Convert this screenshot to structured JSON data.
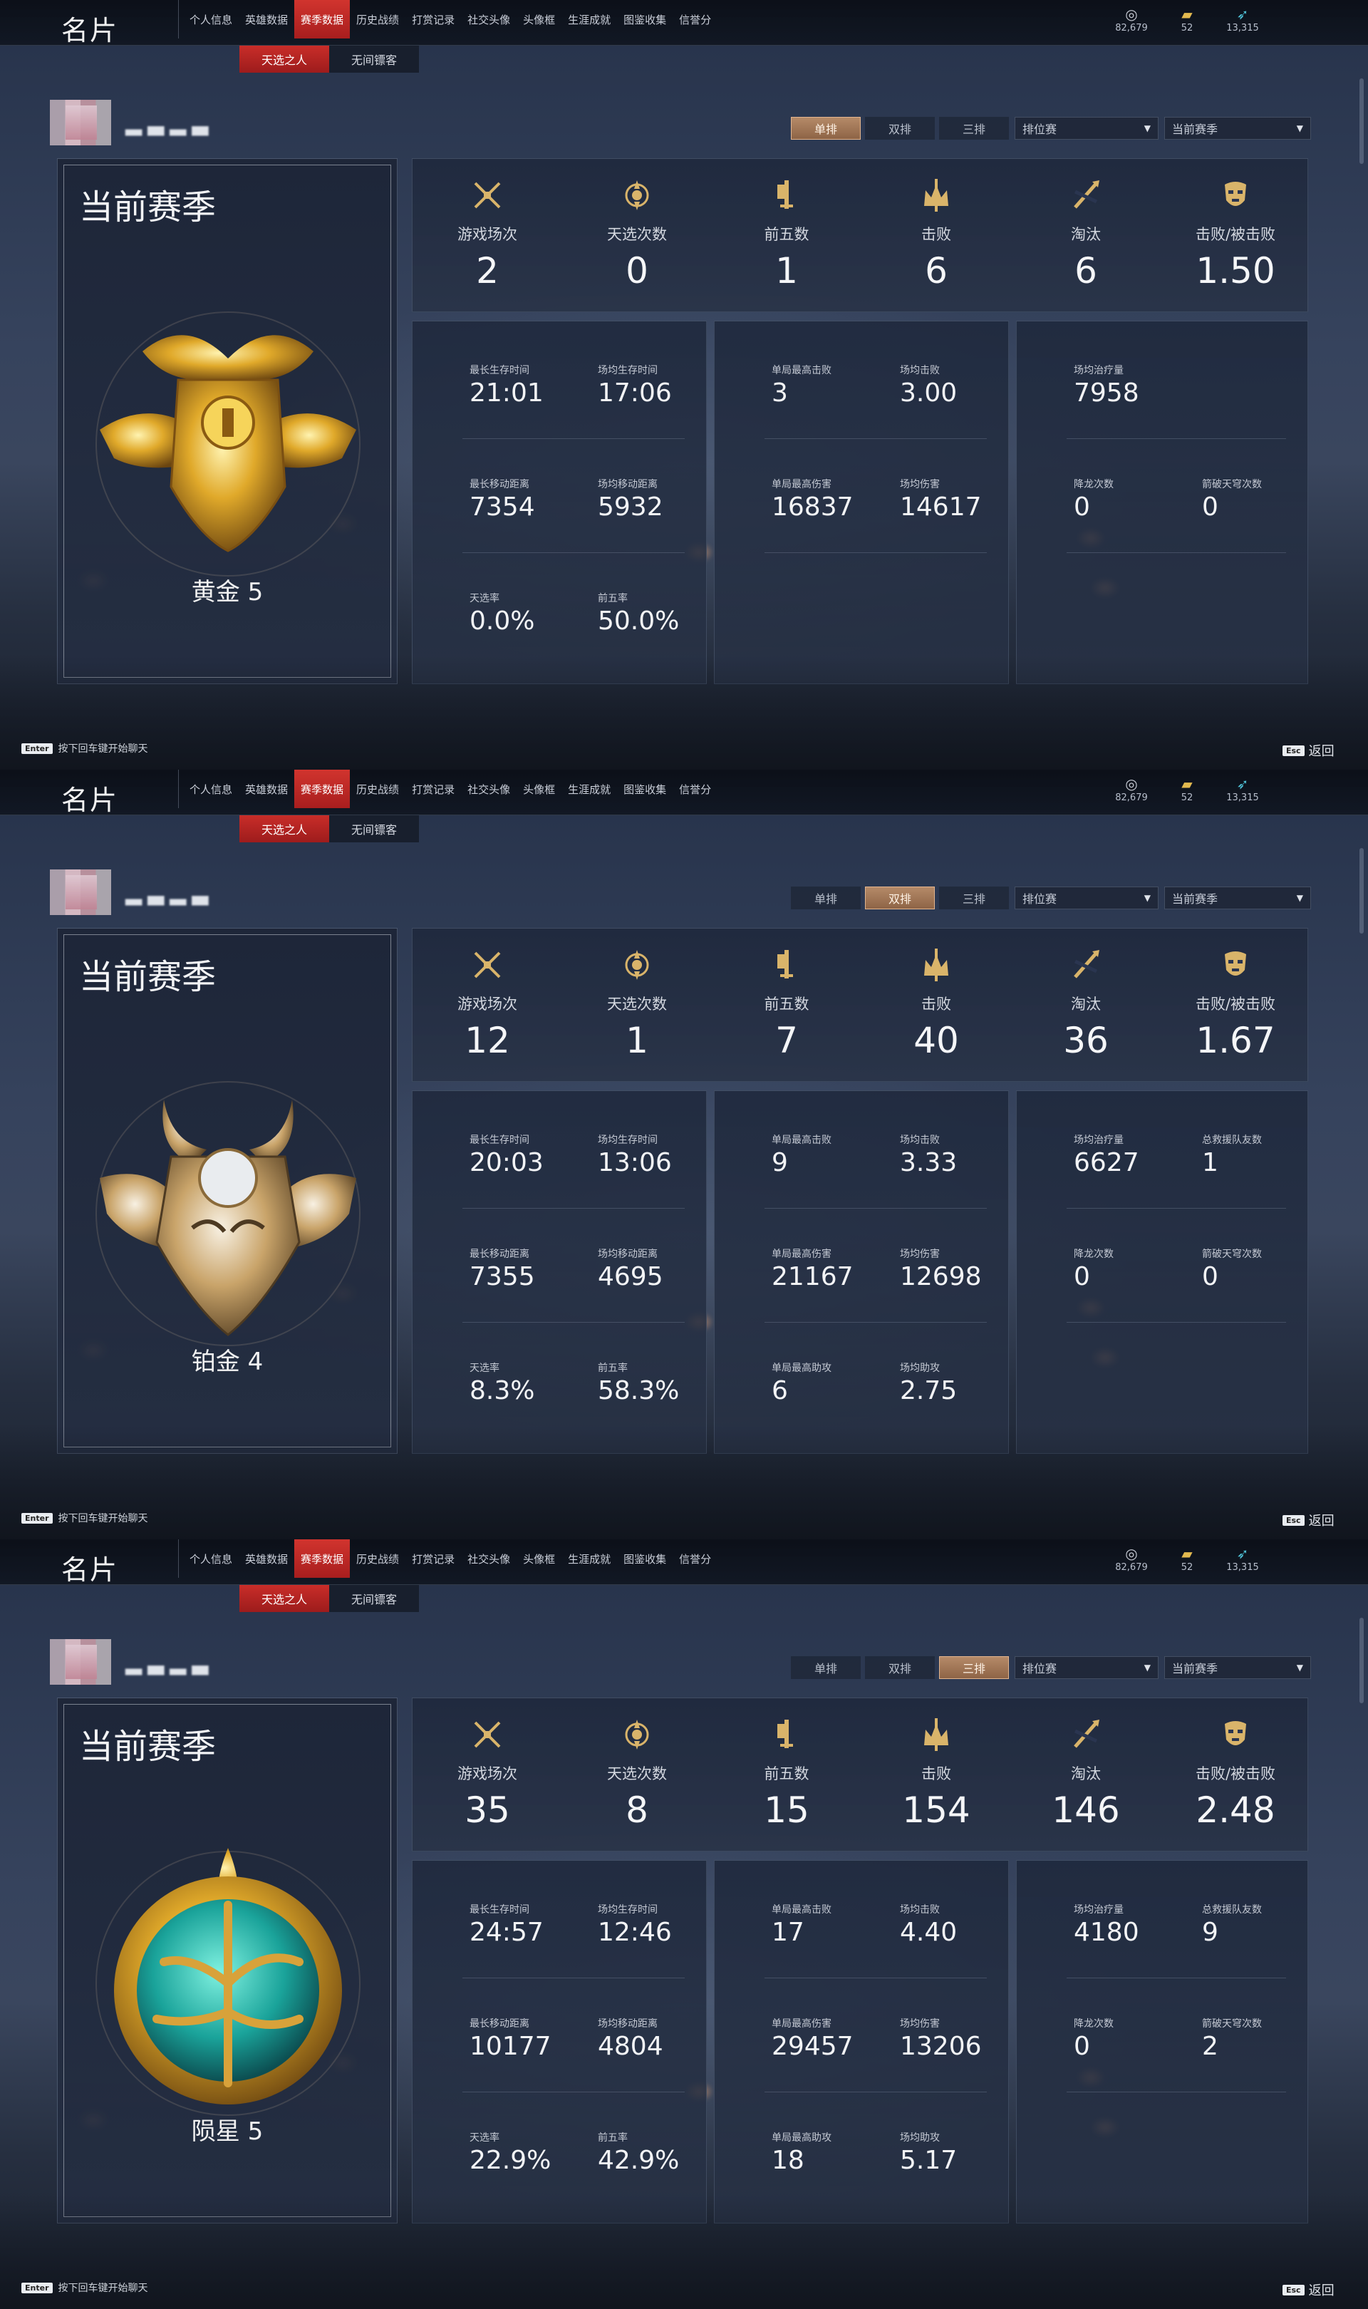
{
  "app_title": "名片",
  "nav": [
    {
      "label": "个人信息",
      "badge": true
    },
    {
      "label": "英雄数据",
      "badge": false
    },
    {
      "label": "赛季数据",
      "badge": false,
      "active": true
    },
    {
      "label": "历史战绩",
      "badge": false
    },
    {
      "label": "打赏记录",
      "badge": false
    },
    {
      "label": "社交头像",
      "badge": false
    },
    {
      "label": "头像框",
      "badge": false
    },
    {
      "label": "生涯成就",
      "badge": true
    },
    {
      "label": "图鉴收集",
      "badge": false
    },
    {
      "label": "信誉分",
      "badge": false
    }
  ],
  "subtabs": [
    {
      "label": "天选之人",
      "active": true
    },
    {
      "label": "无间镖客",
      "active": false
    }
  ],
  "currencies": [
    {
      "icon": "silver-coin-icon",
      "glyph": "◎",
      "color": "#c9cdd6",
      "value": "82,679"
    },
    {
      "icon": "gold-ticket-icon",
      "glyph": "▰",
      "color": "#e2b94f",
      "value": "52"
    },
    {
      "icon": "jade-feather-icon",
      "glyph": "➶",
      "color": "#4fc3d8",
      "value": "13,315"
    }
  ],
  "modes": [
    "单排",
    "双排",
    "三排"
  ],
  "dropdown_match": "排位赛",
  "dropdown_season": "当前赛季",
  "season_label": "当前赛季",
  "chat_hint": {
    "key": "Enter",
    "text": "按下回车键开始聊天"
  },
  "back": {
    "key": "Esc",
    "text": "返回"
  },
  "stat_labels": [
    "游戏场次",
    "天选次数",
    "前五数",
    "击败",
    "淘汰",
    "击败/被击败"
  ],
  "screens": [
    {
      "active_mode": "单排",
      "rank": {
        "name": "黄金 5",
        "tier": "gold"
      },
      "top_values": [
        "2",
        "0",
        "1",
        "6",
        "6",
        "1.50"
      ],
      "panels": [
        [
          {
            "label": "最长生存时间",
            "value": "21:01"
          },
          {
            "label": "场均生存时间",
            "value": "17:06"
          },
          {
            "label": "最长移动距离",
            "value": "7354"
          },
          {
            "label": "场均移动距离",
            "value": "5932"
          },
          {
            "label": "天选率",
            "value": "0.0%"
          },
          {
            "label": "前五率",
            "value": "50.0%"
          }
        ],
        [
          {
            "label": "单局最高击败",
            "value": "3"
          },
          {
            "label": "场均击败",
            "value": "3.00"
          },
          {
            "label": "单局最高伤害",
            "value": "16837"
          },
          {
            "label": "场均伤害",
            "value": "14617"
          }
        ],
        [
          {
            "label": "场均治疗量",
            "value": "7958"
          },
          null,
          {
            "label": "降龙次数",
            "value": "0"
          },
          {
            "label": "箭破天穹次数",
            "value": "0"
          }
        ]
      ]
    },
    {
      "active_mode": "双排",
      "rank": {
        "name": "铂金 4",
        "tier": "platinum"
      },
      "top_values": [
        "12",
        "1",
        "7",
        "40",
        "36",
        "1.67"
      ],
      "panels": [
        [
          {
            "label": "最长生存时间",
            "value": "20:03"
          },
          {
            "label": "场均生存时间",
            "value": "13:06"
          },
          {
            "label": "最长移动距离",
            "value": "7355"
          },
          {
            "label": "场均移动距离",
            "value": "4695"
          },
          {
            "label": "天选率",
            "value": "8.3%"
          },
          {
            "label": "前五率",
            "value": "58.3%"
          }
        ],
        [
          {
            "label": "单局最高击败",
            "value": "9"
          },
          {
            "label": "场均击败",
            "value": "3.33"
          },
          {
            "label": "单局最高伤害",
            "value": "21167"
          },
          {
            "label": "场均伤害",
            "value": "12698"
          },
          {
            "label": "单局最高助攻",
            "value": "6"
          },
          {
            "label": "场均助攻",
            "value": "2.75"
          }
        ],
        [
          {
            "label": "场均治疗量",
            "value": "6627"
          },
          {
            "label": "总救援队友数",
            "value": "1"
          },
          {
            "label": "降龙次数",
            "value": "0"
          },
          {
            "label": "箭破天穹次数",
            "value": "0"
          }
        ]
      ]
    },
    {
      "active_mode": "三排",
      "rank": {
        "name": "陨星 5",
        "tier": "meteor"
      },
      "top_values": [
        "35",
        "8",
        "15",
        "154",
        "146",
        "2.48"
      ],
      "panels": [
        [
          {
            "label": "最长生存时间",
            "value": "24:57"
          },
          {
            "label": "场均生存时间",
            "value": "12:46"
          },
          {
            "label": "最长移动距离",
            "value": "10177"
          },
          {
            "label": "场均移动距离",
            "value": "4804"
          },
          {
            "label": "天选率",
            "value": "22.9%"
          },
          {
            "label": "前五率",
            "value": "42.9%"
          }
        ],
        [
          {
            "label": "单局最高击败",
            "value": "17"
          },
          {
            "label": "场均击败",
            "value": "4.40"
          },
          {
            "label": "单局最高伤害",
            "value": "29457"
          },
          {
            "label": "场均伤害",
            "value": "13206"
          },
          {
            "label": "单局最高助攻",
            "value": "18"
          },
          {
            "label": "场均助攻",
            "value": "5.17"
          }
        ],
        [
          {
            "label": "场均治疗量",
            "value": "4180"
          },
          {
            "label": "总救援队友数",
            "value": "9"
          },
          {
            "label": "降龙次数",
            "value": "0"
          },
          {
            "label": "箭破天穹次数",
            "value": "2"
          }
        ]
      ]
    }
  ]
}
